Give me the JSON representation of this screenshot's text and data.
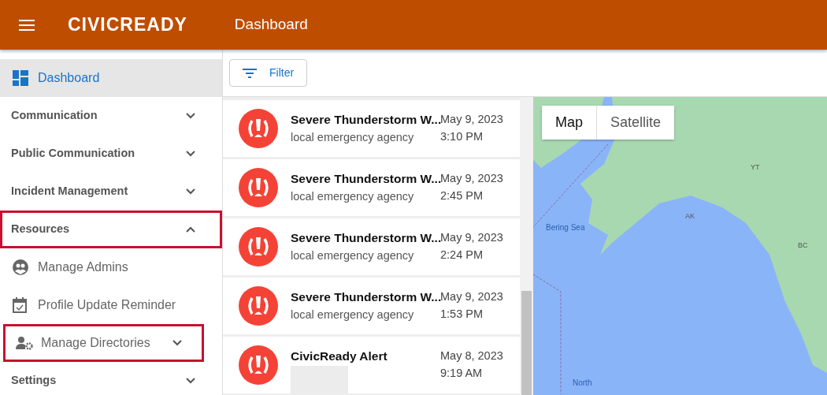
{
  "header": {
    "logo": "CIVICREADY",
    "title": "Dashboard"
  },
  "sidebar": {
    "items": [
      {
        "label": "Dashboard",
        "kind": "top",
        "selected": true,
        "highlighted": false
      },
      {
        "label": "Communication",
        "kind": "group",
        "selected": false,
        "expanded": false,
        "highlighted": false
      },
      {
        "label": "Public Communication",
        "kind": "group",
        "selected": false,
        "expanded": false,
        "highlighted": false
      },
      {
        "label": "Incident Management",
        "kind": "group",
        "selected": false,
        "expanded": false,
        "highlighted": false
      },
      {
        "label": "Resources",
        "kind": "group",
        "selected": false,
        "expanded": true,
        "highlighted": true
      },
      {
        "label": "Manage Admins",
        "kind": "sub",
        "selected": false,
        "highlighted": false
      },
      {
        "label": "Profile Update Reminder",
        "kind": "sub",
        "selected": false,
        "highlighted": false
      },
      {
        "label": "Manage Directories",
        "kind": "subgroup",
        "selected": false,
        "expanded": false,
        "highlighted": true
      },
      {
        "label": "Settings",
        "kind": "group",
        "selected": false,
        "expanded": false,
        "highlighted": false
      }
    ]
  },
  "filter_button": "Filter",
  "alerts": [
    {
      "title": "Severe Thunderstorm W...",
      "subtitle": "local emergency agency",
      "date": "May 9, 2023",
      "time": "3:10 PM"
    },
    {
      "title": "Severe Thunderstorm W...",
      "subtitle": "local emergency agency",
      "date": "May 9, 2023",
      "time": "2:45 PM"
    },
    {
      "title": "Severe Thunderstorm W...",
      "subtitle": "local emergency agency",
      "date": "May 9, 2023",
      "time": "2:24 PM"
    },
    {
      "title": "Severe Thunderstorm W...",
      "subtitle": "local emergency agency",
      "date": "May 9, 2023",
      "time": "1:53 PM"
    },
    {
      "title": "CivicReady Alert",
      "date": "May 8, 2023",
      "time": "9:19 AM",
      "redacted": true
    }
  ],
  "map": {
    "types": [
      {
        "label": "Map",
        "selected": true
      },
      {
        "label": "Satellite",
        "selected": false
      }
    ],
    "labels": [
      {
        "text": "AK",
        "kind": "region"
      },
      {
        "text": "YT",
        "kind": "region"
      },
      {
        "text": "BC",
        "kind": "region"
      },
      {
        "text": "Bering Sea",
        "kind": "water"
      },
      {
        "text": "North",
        "kind": "water"
      }
    ]
  }
}
